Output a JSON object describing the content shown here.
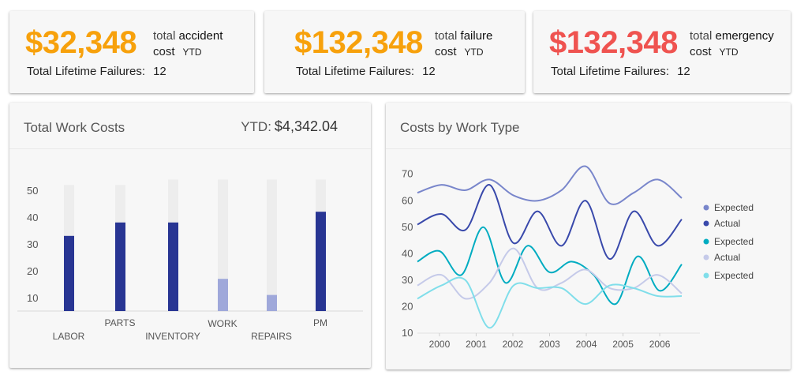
{
  "stats": [
    {
      "amount": "$32,348",
      "label_pre": "total",
      "label_key": "accident",
      "label_line2": "cost",
      "label_sub": "YTD",
      "lifetime_label": "Total Lifetime Failures:",
      "lifetime_value": "12",
      "color": "#f7a10c"
    },
    {
      "amount": "$132,348",
      "label_pre": "total",
      "label_key": "failure",
      "label_line2": "cost",
      "label_sub": "YTD",
      "lifetime_label": "Total Lifetime Failures:",
      "lifetime_value": "12",
      "color": "#f7a10c"
    },
    {
      "amount": "$132,348",
      "label_pre": "total",
      "label_key": "emergency",
      "label_line2": "cost",
      "label_sub": "YTD",
      "lifetime_label": "Total Lifetime Failures:",
      "lifetime_value": "12",
      "color": "#ef5350"
    }
  ],
  "work_costs": {
    "title": "Total Work Costs",
    "ytd_label": "YTD:",
    "ytd_value": "$4,342.04"
  },
  "work_type": {
    "title": "Costs by Work Type"
  },
  "chart_data": [
    {
      "type": "bar",
      "categories": [
        "LABOR",
        "PARTS",
        "INVENTORY",
        "WORK",
        "REPAIRS",
        "PM"
      ],
      "values": [
        33,
        38,
        38,
        17,
        11,
        42
      ],
      "totals": [
        52,
        52,
        54,
        54,
        54,
        54
      ],
      "yticks": [
        10,
        20,
        30,
        40,
        50
      ],
      "ylim": [
        5,
        55
      ],
      "colors": {
        "primary": "#283593",
        "light": "#9fa8da",
        "track": "#ededed"
      }
    },
    {
      "type": "line",
      "x": [
        1999.4,
        2000,
        2000.5,
        2001,
        2001.5,
        2002,
        2002.5,
        2003,
        2003.5,
        2004,
        2004.5,
        2005,
        2005.5,
        2006
      ],
      "xticks": [
        2000,
        2001,
        2002,
        2003,
        2004,
        2005,
        2006
      ],
      "yticks": [
        10,
        20,
        30,
        40,
        50,
        60,
        70
      ],
      "ylim": [
        10,
        72
      ],
      "xlim": [
        1999.4,
        2006.6
      ],
      "series": [
        {
          "name": "Expected",
          "color": "#7986cb",
          "values": [
            63,
            66,
            64,
            68,
            62,
            60,
            64,
            73,
            59,
            63,
            68,
            61
          ]
        },
        {
          "name": "Actual",
          "color": "#3949ab",
          "values": [
            51,
            55,
            49,
            66,
            44,
            56,
            43,
            60,
            38,
            56,
            43,
            53
          ]
        },
        {
          "name": "Expected",
          "color": "#00acc1",
          "values": [
            37,
            41,
            32,
            50,
            29,
            43,
            33,
            37,
            32,
            21,
            39,
            26,
            36
          ]
        },
        {
          "name": "Actual",
          "color": "#c5cae9",
          "values": [
            28,
            32,
            23,
            29,
            42,
            27,
            29,
            34,
            27,
            27,
            32,
            25
          ]
        },
        {
          "name": "Expected",
          "color": "#80deea",
          "values": [
            23,
            28,
            30,
            12,
            28,
            27,
            27,
            21,
            28,
            27,
            24,
            24
          ]
        }
      ]
    }
  ]
}
